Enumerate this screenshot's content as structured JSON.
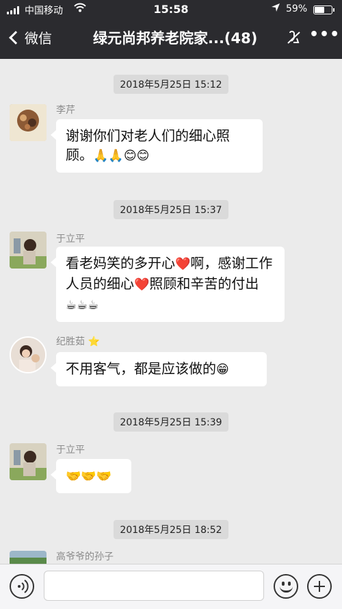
{
  "status_bar": {
    "carrier": "中国移动",
    "time": "15:58",
    "battery_pct": "59%",
    "battery_level": 0.59
  },
  "nav": {
    "back_label": "微信",
    "title": "绿元尚邦养老院家...(48)",
    "icons": [
      "chevron-left-icon",
      "mute-icon",
      "more-icon"
    ]
  },
  "timestamps": [
    "2018年5月25日 15:12",
    "2018年5月25日 15:37",
    "2018年5月25日 15:39",
    "2018年5月25日 18:52"
  ],
  "messages": [
    {
      "sender": "李芹",
      "text": "谢谢你们对老人们的细心照顾。",
      "emoji": "🙏🙏😊😊"
    },
    {
      "sender": "于立平",
      "text_1": "看老妈笑的多开心",
      "emoji_1": "❤️",
      "text_2": "啊，感谢工作人员的细心",
      "emoji_2": "❤️",
      "text_3": "照顾和辛苦的付出",
      "emoji_3": "☕☕☕"
    },
    {
      "sender": "纪胜茹",
      "sender_badge": "⭐",
      "text": "不用客气，都是应该做的",
      "emoji": "😁"
    },
    {
      "sender": "于立平",
      "text": "🤝🤝🤝"
    },
    {
      "sender": "高爷爷的孙子"
    }
  ],
  "input_bar": {
    "placeholder": "",
    "icons": [
      "voice-icon",
      "emoji-icon",
      "plus-icon"
    ]
  },
  "colors": {
    "nav_bg": "#2b2b2f",
    "chat_bg": "#ebebeb",
    "bubble_bg": "#ffffff",
    "timestamp_bg": "#dadada"
  }
}
